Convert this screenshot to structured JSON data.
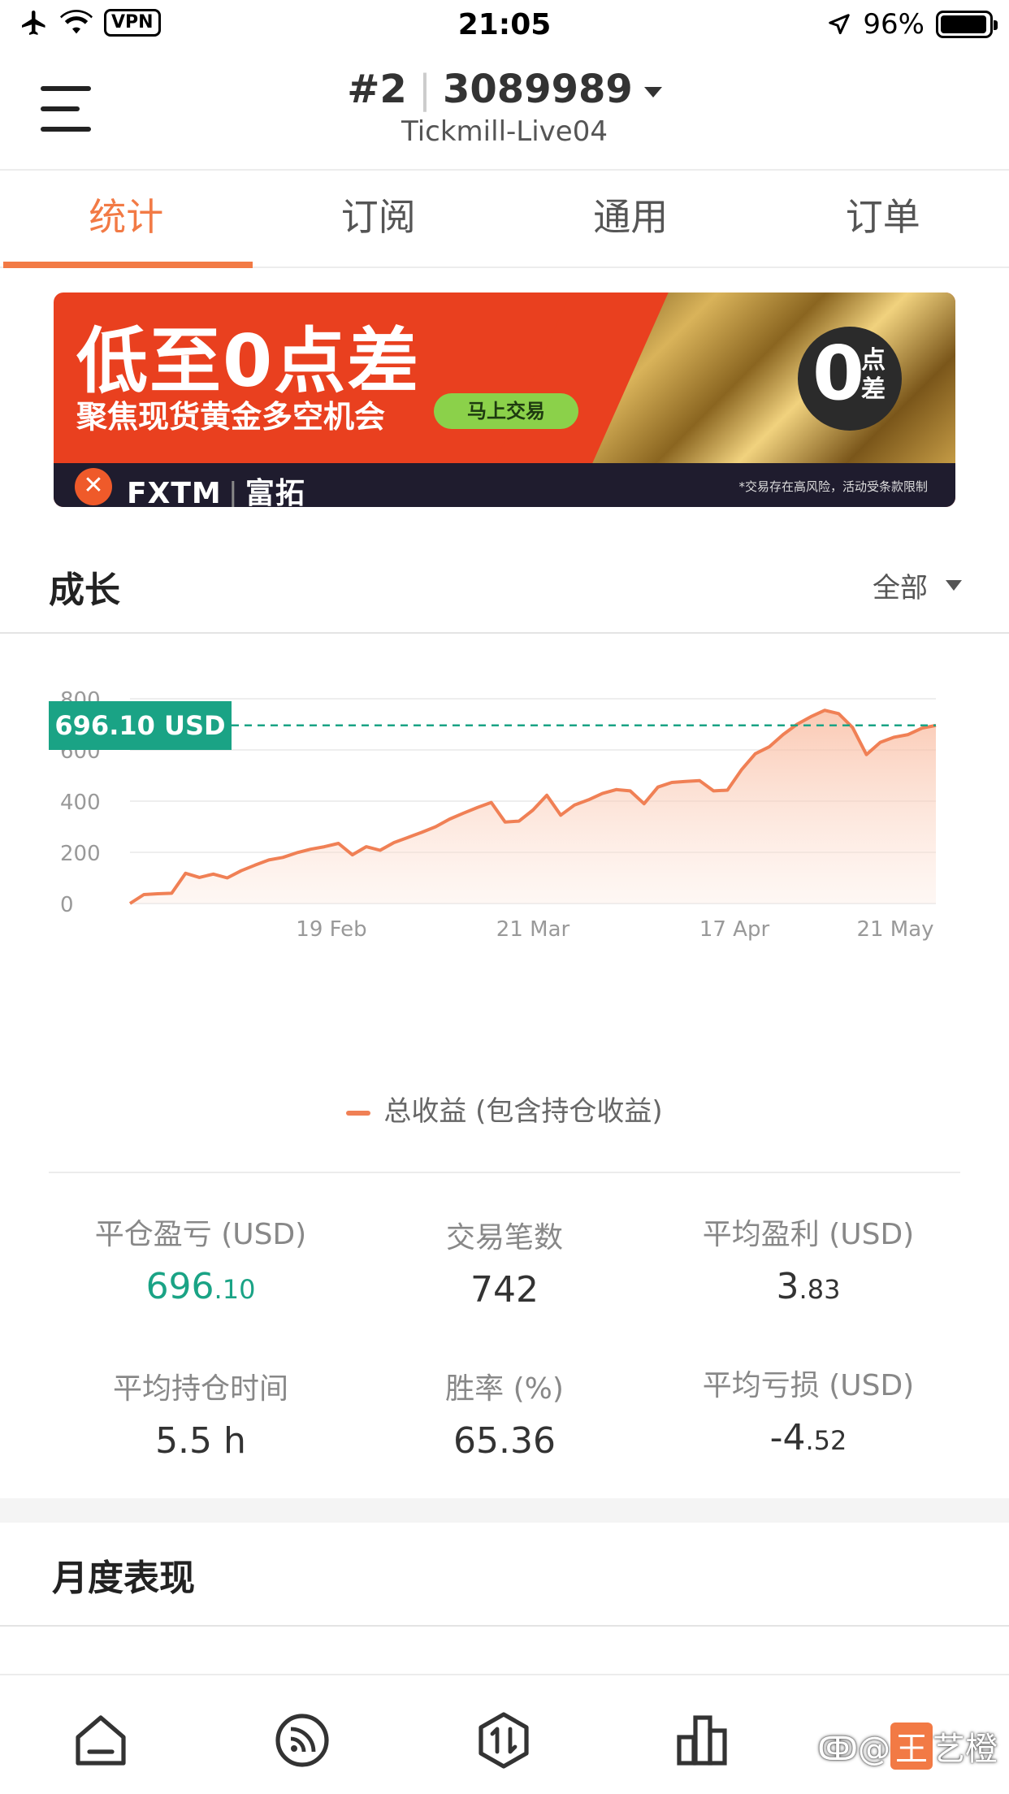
{
  "status_bar": {
    "time": "21:05",
    "vpn": "VPN",
    "battery_percent": "96%",
    "battery_level": 0.96
  },
  "header": {
    "account_index": "#2",
    "account_number": "3089989",
    "server": "Tickmill-Live04"
  },
  "tabs": [
    {
      "label": "统计",
      "active": true
    },
    {
      "label": "订阅",
      "active": false
    },
    {
      "label": "通用",
      "active": false
    },
    {
      "label": "订单",
      "active": false
    }
  ],
  "banner": {
    "headline": "低至0点差",
    "subline": "聚焦现货黄金多空机会",
    "cta": "马上交易",
    "badge_big": "0",
    "badge_small": "点差",
    "brand": "FXTM",
    "brand_cn": "富拓",
    "risk_note": "*交易存在高风险，活动受条款限制"
  },
  "growth": {
    "title": "成长",
    "filter": "全部"
  },
  "chart_data": {
    "type": "area",
    "current_value_label": "696.10 USD",
    "current_value": 696.1,
    "ylim": [
      0,
      800
    ],
    "yticks": [
      "800",
      "600",
      "400",
      "200",
      "0"
    ],
    "xticks": [
      "19 Feb",
      "21 Mar",
      "17 Apr",
      "21 May"
    ],
    "series": [
      {
        "name": "总收益 (包含持仓收益)",
        "values": [
          0,
          35,
          38,
          40,
          118,
          102,
          115,
          100,
          128,
          150,
          170,
          180,
          198,
          212,
          222,
          235,
          190,
          222,
          208,
          238,
          258,
          278,
          300,
          330,
          353,
          375,
          395,
          318,
          322,
          365,
          423,
          345,
          385,
          405,
          430,
          445,
          440,
          390,
          455,
          473,
          477,
          480,
          440,
          443,
          522,
          585,
          612,
          660,
          700,
          730,
          755,
          742,
          688,
          582,
          630,
          650,
          660,
          685,
          696
        ]
      }
    ],
    "colors": {
      "line": "#f08055",
      "fill": "#fde4d8",
      "current": "#1aa385"
    },
    "grid": true
  },
  "stats": [
    {
      "label": "平仓盈亏 (USD)",
      "int": "696",
      "frac": ".10",
      "green": true
    },
    {
      "label": "交易笔数",
      "int": "742",
      "frac": "",
      "green": false
    },
    {
      "label": "平均盈利 (USD)",
      "int": "3",
      "frac": ".83",
      "green": false
    },
    {
      "label": "平均持仓时间",
      "int": "5.5 h",
      "frac": "",
      "green": false
    },
    {
      "label": "胜率 (%)",
      "int": "65.36",
      "frac": "",
      "green": false
    },
    {
      "label": "平均亏损 (USD)",
      "int": "-4",
      "frac": ".52",
      "green": false
    }
  ],
  "monthly": {
    "title": "月度表现"
  },
  "bottom_nav": [
    {
      "icon": "home-icon"
    },
    {
      "icon": "signal-feed-icon"
    },
    {
      "icon": "trade-icon"
    },
    {
      "icon": "bar-chart-icon"
    }
  ],
  "watermark": {
    "prefix": "@",
    "name_box": "王",
    "name_rest": "艺橙"
  }
}
